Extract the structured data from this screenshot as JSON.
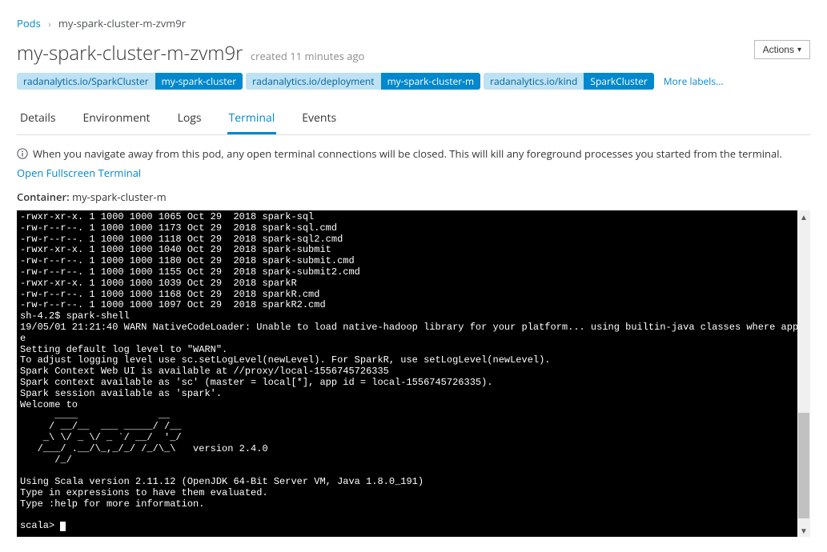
{
  "breadcrumb": {
    "root": "Pods",
    "current": "my-spark-cluster-m-zvm9r"
  },
  "header": {
    "title": "my-spark-cluster-m-zvm9r",
    "created": "created 11 minutes ago"
  },
  "actions": {
    "label": "Actions"
  },
  "labels": [
    {
      "key": "radanalytics.io/SparkCluster",
      "value": "my-spark-cluster"
    },
    {
      "key": "radanalytics.io/deployment",
      "value": "my-spark-cluster-m"
    },
    {
      "key": "radanalytics.io/kind",
      "value": "SparkCluster"
    }
  ],
  "more_labels": "More labels...",
  "tabs": [
    {
      "label": "Details",
      "active": false
    },
    {
      "label": "Environment",
      "active": false
    },
    {
      "label": "Logs",
      "active": false
    },
    {
      "label": "Terminal",
      "active": true
    },
    {
      "label": "Events",
      "active": false
    }
  ],
  "notice": "When you navigate away from this pod, any open terminal connections will be closed. This will kill any foreground processes you started from the terminal.",
  "fullscreen_link": "Open Fullscreen Terminal",
  "container": {
    "label": "Container:",
    "name": "my-spark-cluster-m"
  },
  "terminal": {
    "lines": "-rwxr-xr-x. 1 1000 1000 1065 Oct 29  2018 spark-sql\n-rw-r--r--. 1 1000 1000 1173 Oct 29  2018 spark-sql.cmd\n-rw-r--r--. 1 1000 1000 1118 Oct 29  2018 spark-sql2.cmd\n-rwxr-xr-x. 1 1000 1000 1040 Oct 29  2018 spark-submit\n-rw-r--r--. 1 1000 1000 1180 Oct 29  2018 spark-submit.cmd\n-rw-r--r--. 1 1000 1000 1155 Oct 29  2018 spark-submit2.cmd\n-rwxr-xr-x. 1 1000 1000 1039 Oct 29  2018 sparkR\n-rw-r--r--. 1 1000 1000 1168 Oct 29  2018 sparkR.cmd\n-rw-r--r--. 1 1000 1000 1097 Oct 29  2018 sparkR2.cmd\nsh-4.2$ spark-shell\n19/05/01 21:21:40 WARN NativeCodeLoader: Unable to load native-hadoop library for your platform... using builtin-java classes where applicabl\ne\nSetting default log level to \"WARN\".\nTo adjust logging level use sc.setLogLevel(newLevel). For SparkR, use setLogLevel(newLevel).\nSpark Context Web UI is available at //proxy/local-1556745726335\nSpark context available as 'sc' (master = local[*], app id = local-1556745726335).\nSpark session available as 'spark'.\nWelcome to\n      ____              __\n     / __/__  ___ _____/ /__\n    _\\ \\/ _ \\/ _ `/ __/  '_/\n   /___/ .__/\\_,_/_/ /_/\\_\\   version 2.4.0\n      /_/\n\nUsing Scala version 2.11.12 (OpenJDK 64-Bit Server VM, Java 1.8.0_191)\nType in expressions to have them evaluated.\nType :help for more information.\n\nscala> ",
    "prompt": "scala>"
  }
}
